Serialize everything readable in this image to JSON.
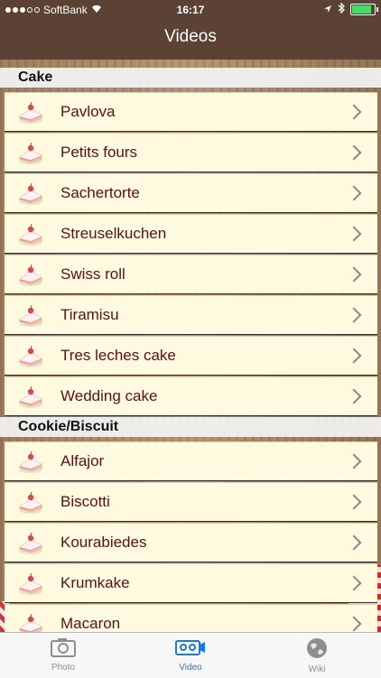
{
  "status_bar": {
    "carrier": "SoftBank",
    "time": "16:17"
  },
  "nav": {
    "title": "Videos"
  },
  "sections": [
    {
      "header": "Cake",
      "items": [
        "Pavlova",
        "Petits fours",
        "Sachertorte",
        "Streuselkuchen",
        "Swiss roll",
        "Tiramisu",
        "Tres leches cake",
        "Wedding cake"
      ]
    },
    {
      "header": "Cookie/Biscuit",
      "items": [
        "Alfajor",
        "Biscotti",
        "Kourabiedes",
        "Krumkake",
        "Macaron"
      ]
    }
  ],
  "tabs": [
    {
      "label": "Photo",
      "icon": "camera-icon",
      "active": false
    },
    {
      "label": "Video",
      "icon": "video-camera-icon",
      "active": true
    },
    {
      "label": "Wiki",
      "icon": "globe-icon",
      "active": false
    }
  ],
  "colors": {
    "nav_bar": "#5b4234",
    "row_bg": "#fff9e0",
    "row_text": "#5a1212",
    "active_tab": "#1b7bd6"
  }
}
